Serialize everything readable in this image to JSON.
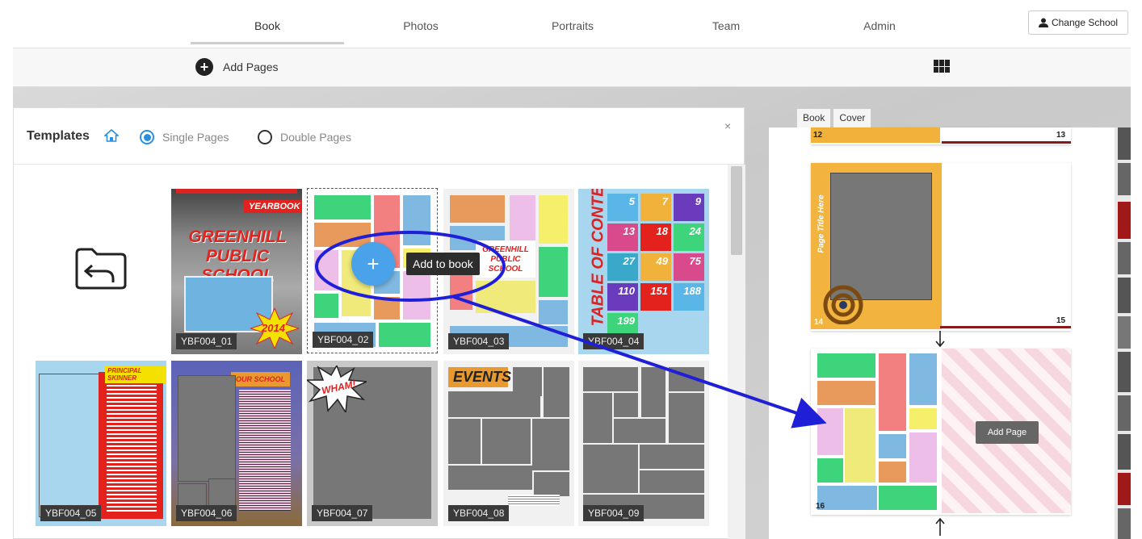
{
  "nav": {
    "tabs": [
      "Book",
      "Photos",
      "Portraits",
      "Team",
      "Admin"
    ],
    "change_school": "Change School"
  },
  "toolbar": {
    "add_pages": "Add Pages"
  },
  "templates": {
    "title": "Templates",
    "single_pages": "Single Pages",
    "double_pages": "Double Pages",
    "close": "×",
    "add_tooltip": "Add to book",
    "add_plus": "+",
    "cards": [
      {
        "label": "YBF004_01",
        "heading": "YEARBOOK",
        "name": "GREENHILL PUBLIC SCHOOL",
        "year": "2014"
      },
      {
        "label": "YBF004_02"
      },
      {
        "label": "YBF004_03",
        "name": "GREENHILL PUBLIC SCHOOL"
      },
      {
        "label": "YBF004_04",
        "heading": "TABLE OF CONTENT",
        "numbers": [
          "5",
          "7",
          "9",
          "13",
          "18",
          "24",
          "27",
          "49",
          "75",
          "110",
          "151",
          "188",
          "199"
        ]
      },
      {
        "label": "YBF004_05",
        "heading": "PRINCIPAL SKINNER"
      },
      {
        "label": "YBF004_06",
        "heading": "OUR SCHOOL"
      },
      {
        "label": "YBF004_07",
        "heading": "WHAM!"
      },
      {
        "label": "YBF004_08",
        "heading": "EVENTS"
      },
      {
        "label": "YBF004_09"
      }
    ]
  },
  "book": {
    "tabs": [
      "Book",
      "Cover"
    ],
    "pages": [
      {
        "left": "12",
        "right": "13"
      },
      {
        "left": "14",
        "right": "15",
        "title": "Page Title Here"
      },
      {
        "left": "16"
      }
    ],
    "add_page": "Add Page"
  },
  "colors": {
    "accent": "#4aa3ea",
    "annotation": "#1f1fd8"
  }
}
